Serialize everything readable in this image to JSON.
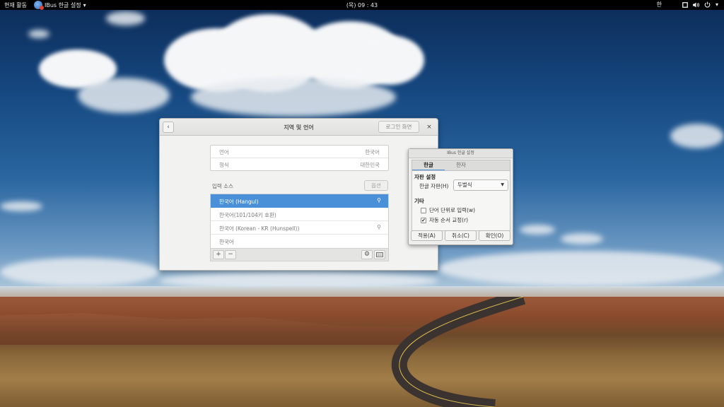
{
  "topbar": {
    "activities": "현재 활동",
    "app_name": "IBus 한글 설정",
    "app_menu_caret": "▾",
    "clock": "(목) 09 : 43",
    "ime_indicator": "한",
    "window_icon": "window-icon",
    "volume_icon": "volume-icon",
    "power_icon": "power-icon",
    "caret": "▾"
  },
  "settings_window": {
    "title": "지역 및 언어",
    "back_icon": "back-arrow-icon",
    "login_screen_button": "로그인 화면",
    "close_icon": "close-icon",
    "language": {
      "label": "언어",
      "value": "한국어"
    },
    "formats": {
      "label": "형식",
      "value": "대한민국"
    },
    "input_sources_label": "입력 소스",
    "options_button": "옵션",
    "input_sources": [
      {
        "label": "한국어 (Hangul)",
        "selected": true,
        "has_settings_icon": true
      },
      {
        "label": "한국어(101/104키 호환)",
        "selected": false,
        "has_settings_icon": false
      },
      {
        "label": "한국어 (Korean - KR (Hunspell))",
        "selected": false,
        "has_settings_icon": true
      },
      {
        "label": "한국어",
        "selected": false,
        "has_settings_icon": false
      }
    ],
    "toolbar": {
      "add": "+",
      "remove": "−",
      "settings_icon": "gear-icon",
      "keyboard_icon": "keyboard-icon"
    }
  },
  "ibus_dialog": {
    "title": "IBus 한글 설정",
    "tabs": [
      {
        "label": "한글",
        "active": true
      },
      {
        "label": "한자",
        "active": false
      }
    ],
    "layout_section": "자판 설정",
    "layout_label": "한글 자판(H)",
    "layout_value": "두벌식",
    "misc_section": "기타",
    "word_commit": {
      "label": "단어 단위로 입력(w)",
      "checked": false
    },
    "auto_reorder": {
      "label": "자동 순서 교정(r)",
      "checked": true
    },
    "apply_button": "적용(A)",
    "cancel_button": "취소(C)",
    "ok_button": "확인(O)"
  },
  "colors": {
    "accent": "#4a90d9",
    "topbar_bg": "#000000"
  }
}
